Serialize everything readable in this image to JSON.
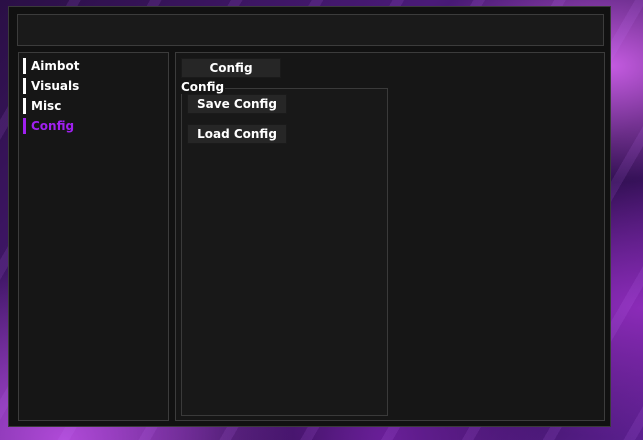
{
  "sidebar": {
    "items": [
      {
        "label": "Aimbot",
        "active": false
      },
      {
        "label": "Visuals",
        "active": false
      },
      {
        "label": "Misc",
        "active": false
      },
      {
        "label": "Config",
        "active": true
      }
    ]
  },
  "content": {
    "tab_label": "Config",
    "group": {
      "title": "Config",
      "buttons": [
        "Save Config",
        "Load Config"
      ]
    }
  },
  "colors": {
    "accent": "#a020f0",
    "panel": "#161616",
    "button": "#262626"
  }
}
